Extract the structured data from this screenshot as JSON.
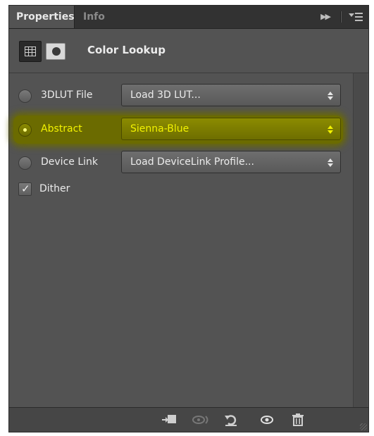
{
  "tabs": [
    {
      "label": "Properties",
      "active": true
    },
    {
      "label": "Info",
      "active": false
    }
  ],
  "panel_controls": {
    "collapse_glyph": "▶▶",
    "menu_icon": "panel-menu-icon"
  },
  "header": {
    "title": "Color Lookup",
    "adjustment_icon": "grid-adjustment-icon",
    "mask_icon": "layer-mask-icon"
  },
  "rows": [
    {
      "label": "3DLUT File",
      "value": "Load 3D LUT...",
      "selected": false
    },
    {
      "label": "Abstract",
      "value": "Sienna-Blue",
      "selected": true
    },
    {
      "label": "Device Link",
      "value": "Load DeviceLink Profile...",
      "selected": false
    }
  ],
  "dither": {
    "label": "Dither",
    "checked": true
  },
  "toolbar": {
    "clip_icon": "clip-to-layer-icon",
    "view_previous_icon": "view-previous-state-icon",
    "reset_icon": "reset-icon",
    "visibility_icon": "eye-icon",
    "delete_icon": "trash-icon"
  },
  "colors": {
    "panel": "#535353",
    "tabbar": "#323232",
    "highlight": "#6b6b00",
    "highlight_text": "#f2f200",
    "text": "#ececec"
  }
}
